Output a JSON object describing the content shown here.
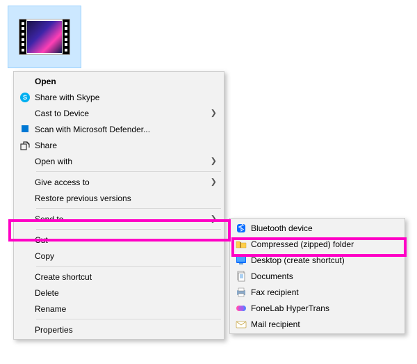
{
  "file": {
    "type": "video"
  },
  "main_menu": {
    "open": "Open",
    "share_skype": "Share with Skype",
    "cast": "Cast to Device",
    "scan_defender": "Scan with Microsoft Defender...",
    "share": "Share",
    "open_with": "Open with",
    "give_access": "Give access to",
    "restore": "Restore previous versions",
    "send_to": "Send to",
    "cut": "Cut",
    "copy": "Copy",
    "create_shortcut": "Create shortcut",
    "delete": "Delete",
    "rename": "Rename",
    "properties": "Properties"
  },
  "send_to_menu": {
    "bluetooth": "Bluetooth device",
    "zip": "Compressed (zipped) folder",
    "desktop": "Desktop (create shortcut)",
    "documents": "Documents",
    "fax": "Fax recipient",
    "fonelab": "FoneLab HyperTrans",
    "mail": "Mail recipient"
  },
  "highlight": {
    "color": "#ff00c6",
    "targets": [
      "send_to",
      "compressed_zip"
    ]
  }
}
